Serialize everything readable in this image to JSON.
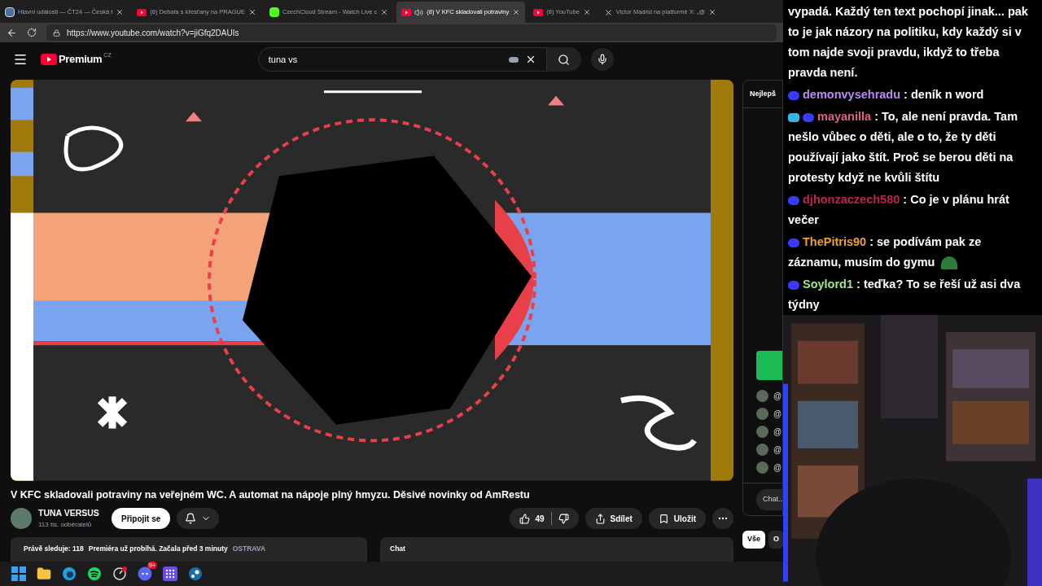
{
  "browser": {
    "tabs": [
      {
        "title": "Hlavní události — ČT24 — Česká t",
        "kind": "page",
        "audio": false,
        "selected": false
      },
      {
        "title": "(8) Debata s křesťany na PRAGUE",
        "kind": "youtube",
        "audio": false,
        "selected": false
      },
      {
        "title": "CzechCloud Stream - Watch Live c",
        "kind": "k",
        "audio": false,
        "selected": false
      },
      {
        "title": "(8) V KFC skladovali potraviny",
        "kind": "youtube",
        "audio": true,
        "selected": true
      },
      {
        "title": "(8) YouTube",
        "kind": "youtube",
        "audio": false,
        "selected": false
      },
      {
        "title": "Victor Madrid na platformě X: „@",
        "kind": "x",
        "audio": false,
        "selected": false
      }
    ],
    "address": "https://www.youtube.com/watch?v=jiGfq2DAUIs"
  },
  "youtube": {
    "logo": "Premium",
    "region": "CZ",
    "search": "tuna vs",
    "title": "V KFC skladovali potraviny na veřejném WC. A automat na nápoje plný hmyzu. Děsivé novinky od AmRestu",
    "channel": {
      "name": "TUNA VERSUS",
      "subscribers": "113 tis. odběratelů"
    },
    "join": "Připojit se",
    "likes": "49",
    "share": "Sdílet",
    "save": "Uložit",
    "info": {
      "viewers": "Právě sleduje: 118",
      "status": "Premiéra už probíhá. Začala před 3 minuty",
      "location": "OSTRAVA"
    },
    "chat_label": "Chat",
    "sidebar": {
      "header": "Nejlepš",
      "mentions": [
        "@",
        "@",
        "@",
        "@",
        "@"
      ],
      "input": "Chat...",
      "chips": [
        {
          "label": "Vše",
          "selected": true
        },
        {
          "label": "O",
          "selected": false
        }
      ]
    }
  },
  "taskbar": {
    "apps": [
      {
        "kind": "windows"
      },
      {
        "kind": "folder"
      },
      {
        "kind": "edge"
      },
      {
        "kind": "spotify"
      },
      {
        "kind": "dial"
      },
      {
        "kind": "discord",
        "badge": "9+"
      },
      {
        "kind": "grid"
      },
      {
        "kind": "steam"
      }
    ]
  },
  "stream_chat": [
    {
      "kind": "continuation",
      "text": "vypadá. Každý ten text pochopí jinak... pak to je jak názory na politiku, kdy každý si v tom najde svoji pravdu, ikdyž to třeba pravda není."
    },
    {
      "kind": "message",
      "user": "demonvysehradu",
      "color": "#b98cf0",
      "text": ": deník n word",
      "badges": [
        {
          "kind": "sub"
        }
      ],
      "emote": false
    },
    {
      "kind": "message",
      "user": "mayanilla",
      "color": "#e0607e",
      "text": ": To, ale není pravda. Tam nešlo vůbec o děti, ale o to, že ty děti používají jako štít. Proč se berou děti na protesty když ne kvůli štítu",
      "badges": [
        {
          "kind": "mod"
        },
        {
          "kind": "sub"
        }
      ],
      "emote": false
    },
    {
      "kind": "message",
      "user": "djhonzaczech580",
      "color": "#c0244c",
      "text": ": Co je v plánu hrát večer",
      "badges": [
        {
          "kind": "sub"
        }
      ],
      "emote": false
    },
    {
      "kind": "message",
      "user": "ThePitris90",
      "color": "#f0a030",
      "text": ": se podívám pak ze záznamu, musím do gymu",
      "badges": [
        {
          "kind": "sub"
        }
      ],
      "emote": true
    },
    {
      "kind": "message",
      "user": "Soylord1",
      "color": "#a6e08a",
      "text": ": teďka? To se řeší už asi dva týdny",
      "badges": [
        {
          "kind": "sub"
        }
      ],
      "emote": false
    }
  ]
}
